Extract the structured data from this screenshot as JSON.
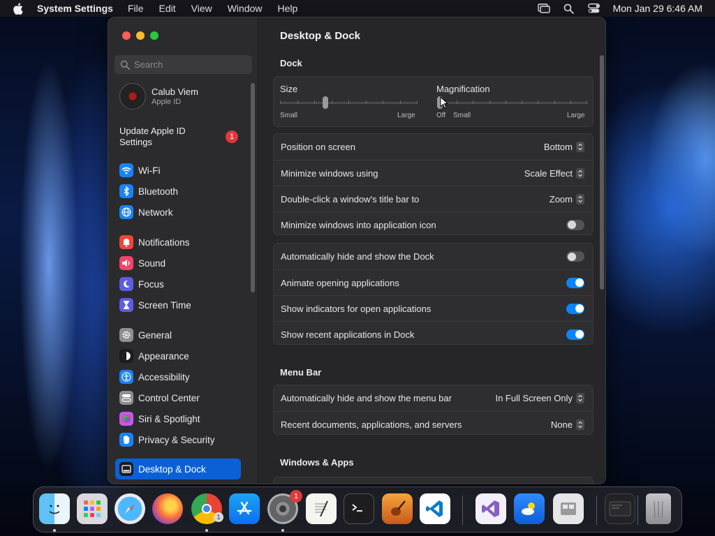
{
  "menubar": {
    "app_name": "System Settings",
    "items": [
      "File",
      "Edit",
      "View",
      "Window",
      "Help"
    ],
    "clock": "Mon Jan 29  6:46 AM"
  },
  "window": {
    "title": "Desktop & Dock",
    "search_placeholder": "Search",
    "account": {
      "name": "Calub Viem",
      "subtitle": "Apple ID"
    },
    "update": {
      "label": "Update Apple ID Settings",
      "badge": "1"
    },
    "sidebar": [
      {
        "label": "Wi-Fi",
        "icon": "wifi-icon",
        "color": "#1a82f7"
      },
      {
        "label": "Bluetooth",
        "icon": "bluetooth-icon",
        "color": "#1a82f7"
      },
      {
        "label": "Network",
        "icon": "globe-icon",
        "color": "#1a82f7"
      },
      {
        "label": "Notifications",
        "icon": "bell-icon",
        "color": "#f0453a"
      },
      {
        "label": "Sound",
        "icon": "speaker-icon",
        "color": "#f0456a"
      },
      {
        "label": "Focus",
        "icon": "moon-icon",
        "color": "#5e5ce6"
      },
      {
        "label": "Screen Time",
        "icon": "hourglass-icon",
        "color": "#5e5ce6"
      },
      {
        "label": "General",
        "icon": "gear-icon",
        "color": "#8e8e93"
      },
      {
        "label": "Appearance",
        "icon": "appearance-icon",
        "color": "#1c1c1e"
      },
      {
        "label": "Accessibility",
        "icon": "accessibility-icon",
        "color": "#1a82f7"
      },
      {
        "label": "Control Center",
        "icon": "control-center-icon",
        "color": "#8e8e93"
      },
      {
        "label": "Siri & Spotlight",
        "icon": "siri-icon",
        "color": "#bf5af2"
      },
      {
        "label": "Privacy & Security",
        "icon": "hand-icon",
        "color": "#1a82f7"
      },
      {
        "label": "Desktop & Dock",
        "icon": "dock-icon",
        "color": "#1c1c1e",
        "selected": true
      }
    ],
    "dock_section": {
      "heading": "Dock",
      "size": {
        "label": "Size",
        "min": "Small",
        "max": "Large",
        "value": 0.33
      },
      "magnification": {
        "label": "Magnification",
        "off": "Off",
        "min": "Small",
        "max": "Large",
        "value": 0.0
      },
      "rows_a": [
        {
          "label": "Position on screen",
          "value": "Bottom",
          "kind": "popup"
        },
        {
          "label": "Minimize windows using",
          "value": "Scale Effect",
          "kind": "popup"
        },
        {
          "label": "Double-click a window's title bar to",
          "value": "Zoom",
          "kind": "popup"
        },
        {
          "label": "Minimize windows into application icon",
          "value": false,
          "kind": "toggle"
        }
      ],
      "rows_b": [
        {
          "label": "Automatically hide and show the Dock",
          "value": false,
          "kind": "toggle"
        },
        {
          "label": "Animate opening applications",
          "value": true,
          "kind": "toggle"
        },
        {
          "label": "Show indicators for open applications",
          "value": true,
          "kind": "toggle"
        },
        {
          "label": "Show recent applications in Dock",
          "value": true,
          "kind": "toggle"
        }
      ]
    },
    "menu_bar_section": {
      "heading": "Menu Bar",
      "rows": [
        {
          "label": "Automatically hide and show the menu bar",
          "value": "In Full Screen Only",
          "kind": "popup"
        },
        {
          "label": "Recent documents, applications, and servers",
          "value": "None",
          "kind": "popup"
        }
      ]
    },
    "windows_apps_section": {
      "heading": "Windows & Apps"
    }
  },
  "dock": {
    "apps": [
      {
        "name": "finder-icon",
        "running": true
      },
      {
        "name": "launchpad-icon",
        "running": false
      },
      {
        "name": "safari-icon",
        "running": false
      },
      {
        "name": "firefox-icon",
        "running": false
      },
      {
        "name": "chrome-icon",
        "running": true,
        "badge": "1"
      },
      {
        "name": "app-store-icon",
        "running": false
      },
      {
        "name": "system-settings-icon",
        "running": true,
        "badge": "1"
      },
      {
        "name": "textedit-icon",
        "running": false
      },
      {
        "name": "terminal-icon",
        "running": false
      },
      {
        "name": "garageband-icon",
        "running": false
      },
      {
        "name": "vscode-icon",
        "running": false
      },
      {
        "name": "visual-studio-icon",
        "running": false
      },
      {
        "name": "weather-icon",
        "running": false
      },
      {
        "name": "boot-camp-icon",
        "running": false
      },
      {
        "name": "recent-window-icon",
        "running": false
      },
      {
        "name": "trash-icon",
        "running": false
      }
    ]
  }
}
